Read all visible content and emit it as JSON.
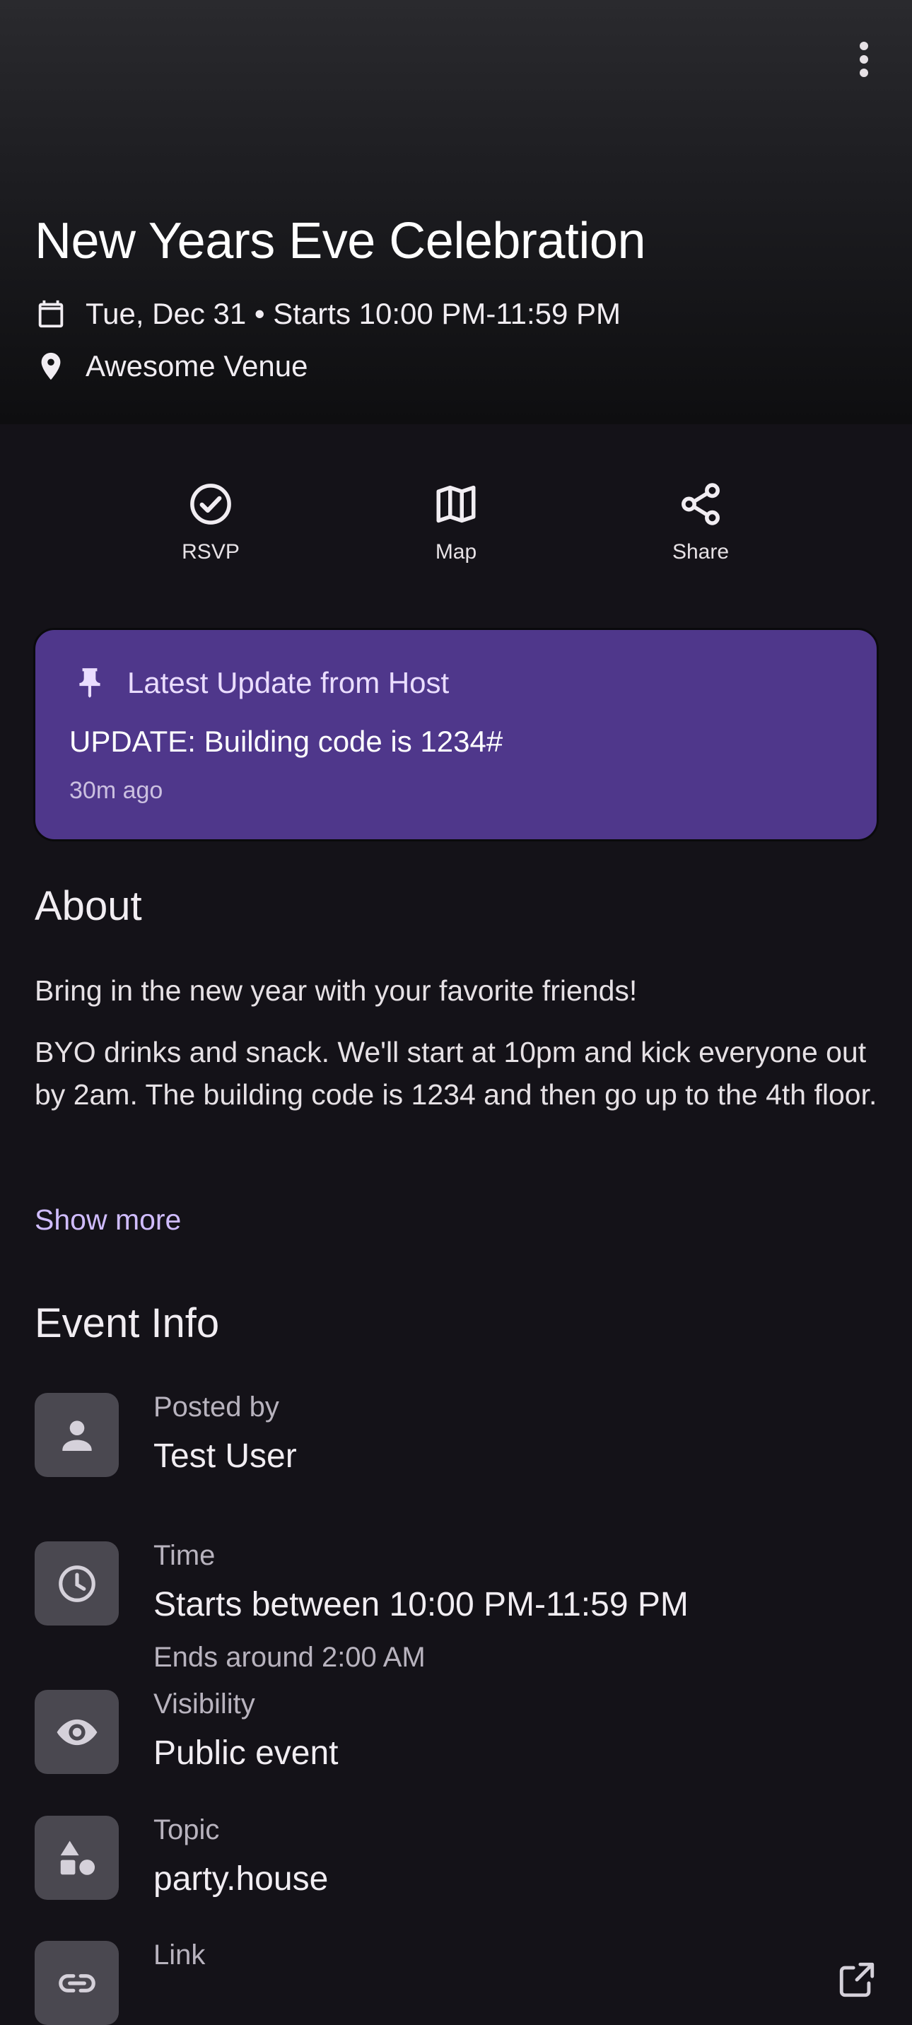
{
  "header": {
    "title": "New Years Eve Celebration",
    "date_line": "Tue, Dec 31 • Starts 10:00 PM-11:59 PM",
    "venue": "Awesome Venue",
    "icons": {
      "more": "more-vert-icon",
      "date": "calendar-icon",
      "venue": "location-pin-icon"
    }
  },
  "actions": [
    {
      "label": "RSVP",
      "icon": "check-circle-icon"
    },
    {
      "label": "Map",
      "icon": "map-icon"
    },
    {
      "label": "Share",
      "icon": "share-icon"
    }
  ],
  "update_card": {
    "heading": "Latest Update from Host",
    "body": "UPDATE: Building code is 1234#",
    "time": "30m ago",
    "icon": "pin-icon",
    "color": "#4F378B"
  },
  "about": {
    "title": "About",
    "line1": "Bring in the new year with your favorite friends!",
    "description": "BYO drinks and snack. We'll start at 10pm and kick everyone out by 2am. The building code is 1234 and then go up to the 4th floor.",
    "show_more": "Show more"
  },
  "event_info": {
    "title": "Event Info",
    "items": [
      {
        "label": "Posted by",
        "value": "Test User",
        "icon": "person-icon"
      },
      {
        "label": "Time",
        "value": "Starts between 10:00 PM-11:59 PM",
        "sub": "Ends around 2:00 AM",
        "icon": "clock-icon"
      },
      {
        "label": "Visibility",
        "value": "Public event",
        "icon": "eye-icon"
      },
      {
        "label": "Topic",
        "value": "party.house",
        "icon": "shapes-icon"
      },
      {
        "label": "Link",
        "icon": "link-icon",
        "trailing_icon": "open-external-icon"
      }
    ]
  },
  "colors": {
    "background": "#141218",
    "accent": "#D0BCFF",
    "card": "#4F378B",
    "tile": "#4A4850"
  }
}
